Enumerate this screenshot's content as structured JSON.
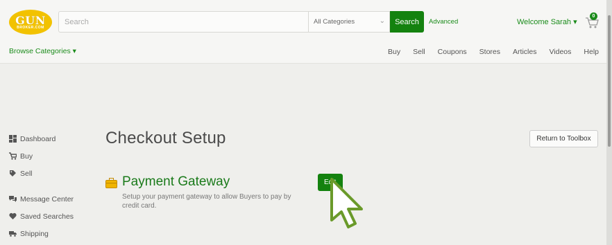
{
  "header": {
    "logo": {
      "main": "GUN",
      "sub": "BROKER.COM"
    },
    "search": {
      "placeholder": "Search",
      "value": ""
    },
    "category": {
      "selected": "All Categories"
    },
    "search_button": "Search",
    "advanced_link": "Advanced",
    "welcome": "Welcome Sarah ▾",
    "cart": {
      "count": "0",
      "icon": "cart-icon"
    }
  },
  "nav": {
    "browse": "Browse Categories ▾",
    "links": [
      "Buy",
      "Sell",
      "Coupons",
      "Stores",
      "Articles",
      "Videos",
      "Help"
    ]
  },
  "sidebar": {
    "items": [
      {
        "label": "Dashboard",
        "icon": "dashboard-icon"
      },
      {
        "label": "Buy",
        "icon": "cart-icon"
      },
      {
        "label": "Sell",
        "icon": "tag-icon"
      },
      {
        "label": "Message Center",
        "icon": "chat-icon"
      },
      {
        "label": "Saved Searches",
        "icon": "heart-icon"
      },
      {
        "label": "Shipping",
        "icon": "truck-icon"
      }
    ]
  },
  "main": {
    "title": "Checkout Setup",
    "return_button": "Return to Toolbox",
    "gateway": {
      "title": "Payment Gateway",
      "description": "Setup your payment gateway to allow Buyers to pay by credit card.",
      "edit_button": "Edit",
      "icon": "briefcase-icon"
    }
  },
  "colors": {
    "brand_green": "#14820f",
    "link_green": "#1a8b1a",
    "logo_yellow": "#f2c200",
    "cursor_green": "#6a9a2a"
  }
}
